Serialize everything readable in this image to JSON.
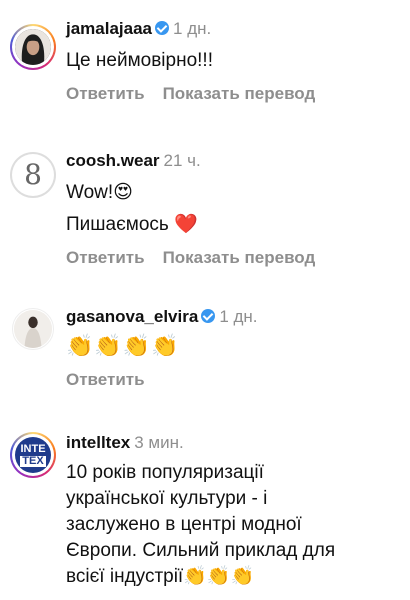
{
  "comments": [
    {
      "username": "jamalajaaa",
      "verified": true,
      "time": "1 дн.",
      "lines": [
        "Це неймовірно!!!"
      ],
      "actions": [
        "Ответить",
        "Показать перевод"
      ]
    },
    {
      "username": "coosh.wear",
      "verified": false,
      "time": "21 ч.",
      "lines": [
        "Wow!😍",
        "Пишаємось ❤️"
      ],
      "actions": [
        "Ответить",
        "Показать перевод"
      ]
    },
    {
      "username": "gasanova_elvira",
      "verified": true,
      "time": "1 дн.",
      "lines": [
        "👏👏👏👏"
      ],
      "actions": [
        "Ответить"
      ]
    },
    {
      "username": "intelltex",
      "verified": false,
      "time": "3 мин.",
      "lines": [
        "10 років популяризації",
        "української культури - і",
        "заслужено в центрі модної",
        "Європи. Сильний приклад для",
        "всієї індустрії👏👏👏"
      ],
      "actions": []
    }
  ],
  "avatars": {
    "coosh_logo": "8",
    "intelltex_logo_top": "INTE",
    "intelltex_logo_bottom": "TEX"
  },
  "colors": {
    "verified_blue": "#3897f0",
    "muted_text": "#8e8e8e",
    "intelltex_brand": "#1f3b8c"
  }
}
